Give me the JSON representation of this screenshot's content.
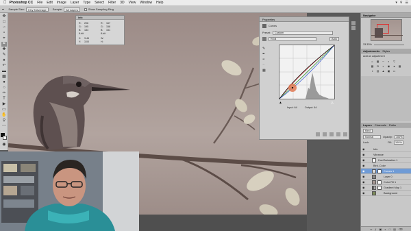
{
  "menubar": {
    "app_name": "Photoshop CC",
    "items": [
      "File",
      "Edit",
      "Image",
      "Layer",
      "Type",
      "Select",
      "Filter",
      "3D",
      "View",
      "Window",
      "Help"
    ]
  },
  "options_bar": {
    "sample_size_label": "Sample Size:",
    "sample_size_value": "5 by 5 Average",
    "sample_label": "Sample:",
    "sample_value": "All Layers",
    "show_ring_label": "Show Sampling Ring"
  },
  "info_panel": {
    "title": "Info",
    "rows": [
      [
        "R:",
        "206",
        "R:",
        "167"
      ],
      [
        "G:",
        "195",
        "G:",
        "158"
      ],
      [
        "B:",
        "184",
        "B:",
        "151"
      ],
      [
        "8-bit",
        "",
        "8-bit",
        ""
      ],
      [
        "X:",
        "3.46",
        "W:",
        ""
      ],
      [
        "Y:",
        "3.00",
        "H:",
        ""
      ]
    ]
  },
  "properties_panel": {
    "title": "Properties",
    "type_label": "Curves",
    "preset_label": "Preset:",
    "preset_value": "Custom",
    "channel_value": "RGB",
    "auto_label": "Auto",
    "input_label": "Input: 64",
    "output_label": "Output: 64"
  },
  "navigator": {
    "title": "Navigator",
    "zoom": "33.33%"
  },
  "adjustments": {
    "tabs": [
      "Adjustments",
      "Styles"
    ],
    "add_label": "Add an adjustment"
  },
  "layers_panel": {
    "tabs": [
      "Layers",
      "Channels",
      "Paths"
    ],
    "kind_label": "Kind",
    "blend_mode": "Normal",
    "opacity_label": "Opacity:",
    "opacity_value": "100%",
    "lock_label": "Lock:",
    "fill_label": "Fill:",
    "fill_value": "100%",
    "layers": [
      {
        "name": "Info",
        "selected": false
      },
      {
        "name": "Vibrance",
        "selected": false
      },
      {
        "name": "Hue/Saturation 1",
        "selected": false
      },
      {
        "name": "Bird_Color",
        "selected": false
      },
      {
        "name": "Curves 1",
        "selected": true
      },
      {
        "name": "Layer 0",
        "selected": false
      },
      {
        "name": "Color Fill 1",
        "selected": false
      },
      {
        "name": "Gradient Map 1",
        "selected": false
      },
      {
        "name": "Background",
        "selected": false
      }
    ]
  },
  "colors": {
    "photo_tint": "#a89994",
    "selection": "#6f9bd6",
    "panel_bg": "#d0d0d0",
    "canvas_bg": "#595959",
    "curve_point": "#e07a55"
  },
  "icons": [
    "apple-icon",
    "eyedropper-icon",
    "eye-icon",
    "curves-adjustment-icon",
    "histogram-icon"
  ]
}
